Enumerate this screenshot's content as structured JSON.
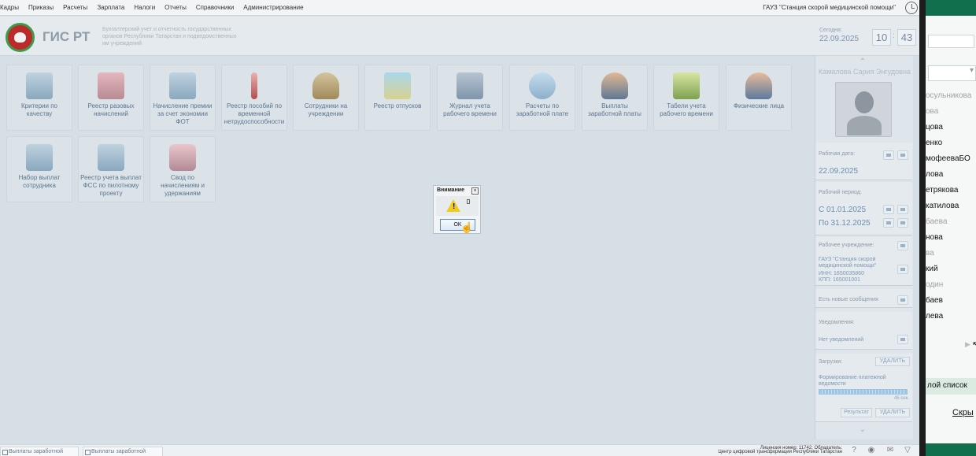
{
  "menu": [
    "Кадры",
    "Приказы",
    "Расчеты",
    "Зарплата",
    "Налоги",
    "Отчеты",
    "Справочники",
    "Администрирование"
  ],
  "organization": "ГАУЗ \"Станция скорой медицинской помощи\"",
  "header": {
    "app_title": "ГИС РТ",
    "subtitle": "Бухгалтерский учет и отчетность государственных органов Республики Татарстан и подведомственных им учреждений",
    "today_label": "Сегодня:",
    "today_date": "22.09.2025",
    "hours": "10",
    "minutes": "43"
  },
  "tiles": [
    {
      "label": "Критерии по качеству",
      "icon": "building-icon"
    },
    {
      "label": "Реестр разовых начислений",
      "icon": "gift-icon"
    },
    {
      "label": "Начисление премии за счет экономии ФОТ",
      "icon": "building-icon"
    },
    {
      "label": "Реестр пособий по временной нетрудоспособности",
      "icon": "thermometer-icon"
    },
    {
      "label": "Сотрудники на учреждении",
      "icon": "person-icon"
    },
    {
      "label": "Реестр отпусков",
      "icon": "palm-icon"
    },
    {
      "label": "Журнал учета рабочего времени",
      "icon": "calendar-icon"
    },
    {
      "label": "Расчеты по заработной плате",
      "icon": "calculator-icon"
    },
    {
      "label": "Выплаты заработной платы",
      "icon": "people-icon"
    },
    {
      "label": "Табели учета рабочего времени",
      "icon": "book-icon"
    },
    {
      "label": "Физические лица",
      "icon": "face-icon"
    },
    {
      "label": "Набор выплат сотрудника",
      "icon": "building-icon"
    },
    {
      "label": "Реестр учета выплат ФСС по пилотному проекту",
      "icon": "building-icon"
    },
    {
      "label": "Свод по начислениям и удержаниям",
      "icon": "pig-icon"
    }
  ],
  "profile": {
    "name": "Камалова Сария Энгудовна"
  },
  "panel": {
    "work_date_label": "Рабочая дата:",
    "work_date": "22.09.2025",
    "period_label": "Рабочий период:",
    "period_from": "С   01.01.2025",
    "period_to": "По 31.12.2025",
    "institution_label": "Рабочее учреждение:",
    "institution_name": "ГАУЗ \"Станция скорой медицинской помощи\"",
    "inn": "ИНН: 1650035860",
    "kpp": "КПП: 165001001",
    "messages": "Есть новые сообщения",
    "notifications_label": "Уведомления:",
    "notifications_text": "Нет уведомлений",
    "downloads_label": "Загрузки:",
    "delete_label": "УДАЛИТЬ",
    "download_name": "Формирование платежной ведомости",
    "download_time": "45 сек.",
    "progress": 1.0,
    "result_label": "Результат",
    "delete_label_2": "УДАЛИТЬ"
  },
  "dialog": {
    "title": "Внимание",
    "ok": "OK"
  },
  "taskbar": {
    "tab1": "Выплаты заработной платы",
    "tab2": "Выплаты заработной платы",
    "license_line1": "Лицензия номер: 11742; Обладатель:",
    "license_line2": "Центр цифровой трансформации Республики Татарстан"
  },
  "right_window": {
    "names": [
      "осульникова",
      "ова",
      "цова",
      "енко",
      "мофееваБО",
      "лова",
      "етрякова",
      "катилова",
      "баева",
      "нова",
      "ва",
      "кий",
      "один",
      "баев",
      "лева"
    ],
    "list_button": "лой список",
    "hide_link": "Скры"
  }
}
